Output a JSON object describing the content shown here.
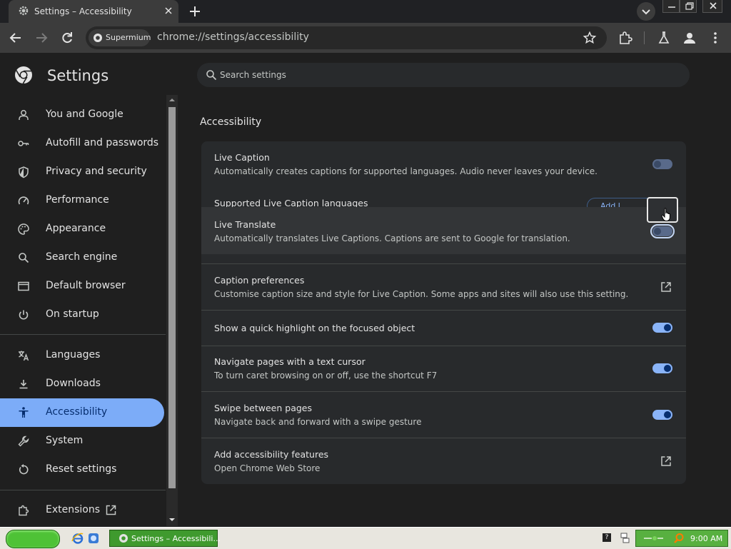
{
  "browser": {
    "tab_title": "Settings – Accessibility",
    "site_chip": "Supermium",
    "url": "chrome://settings/accessibility"
  },
  "settings": {
    "title": "Settings",
    "search_placeholder": "Search settings",
    "nav_group_1": [
      {
        "label": "You and Google",
        "icon": "person-icon"
      },
      {
        "label": "Autofill and passwords",
        "icon": "key-icon"
      },
      {
        "label": "Privacy and security",
        "icon": "shield-icon"
      },
      {
        "label": "Performance",
        "icon": "speedometer-icon"
      },
      {
        "label": "Appearance",
        "icon": "palette-icon"
      },
      {
        "label": "Search engine",
        "icon": "search-icon"
      },
      {
        "label": "Default browser",
        "icon": "browser-window-icon"
      },
      {
        "label": "On startup",
        "icon": "power-icon"
      }
    ],
    "nav_group_2": [
      {
        "label": "Languages",
        "icon": "translate-icon"
      },
      {
        "label": "Downloads",
        "icon": "download-icon"
      },
      {
        "label": "Accessibility",
        "icon": "accessibility-icon"
      },
      {
        "label": "System",
        "icon": "wrench-icon"
      },
      {
        "label": "Reset settings",
        "icon": "reset-icon"
      }
    ],
    "nav_extensions": "Extensions"
  },
  "content": {
    "section_title": "Accessibility",
    "live_caption": {
      "title": "Live Caption",
      "subtitle": "Automatically creates captions for supported languages. Audio never leaves your device.",
      "enabled": false
    },
    "supported_languages": {
      "title": "Supported Live Caption languages",
      "button_label": "Add l..."
    },
    "live_translate": {
      "title": "Live Translate",
      "subtitle": "Automatically translates Live Captions. Captions are sent to Google for translation.",
      "enabled": false
    },
    "caption_prefs": {
      "title": "Caption preferences",
      "subtitle": "Customise caption size and style for Live Caption. Some apps and sites will also use this setting."
    },
    "quick_highlight": {
      "title": "Show a quick highlight on the focused object",
      "enabled": true
    },
    "text_cursor": {
      "title": "Navigate pages with a text cursor",
      "subtitle": "To turn caret browsing on or off, use the shortcut F7",
      "enabled": true
    },
    "swipe": {
      "title": "Swipe between pages",
      "subtitle": "Navigate back and forward with a swipe gesture",
      "enabled": true
    },
    "add_features": {
      "title": "Add accessibility features",
      "subtitle": "Open Chrome Web Store"
    }
  },
  "taskbar": {
    "task_label": "Settings – Accessibili...",
    "clock": "9:00 AM",
    "help": "?"
  },
  "colors": {
    "accent": "#7cacf8",
    "toggle_on": "#8ab4f8",
    "page_bg": "#1f1f1f",
    "card_bg": "#282a2c"
  }
}
